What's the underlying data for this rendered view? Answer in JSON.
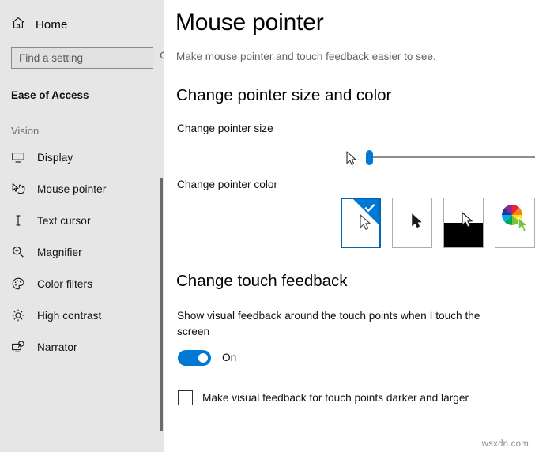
{
  "sidebar": {
    "home_label": "Home",
    "search": {
      "placeholder": "Find a setting",
      "value": "",
      "icon": "search-icon"
    },
    "section_title": "Ease of Access",
    "group_label": "Vision",
    "items": [
      {
        "label": "Display",
        "icon": "monitor-icon",
        "selected": false
      },
      {
        "label": "Mouse pointer",
        "icon": "mouse-pointer-icon",
        "selected": true
      },
      {
        "label": "Text cursor",
        "icon": "text-cursor-icon",
        "selected": false
      },
      {
        "label": "Magnifier",
        "icon": "magnifier-icon",
        "selected": false
      },
      {
        "label": "Color filters",
        "icon": "palette-icon",
        "selected": false
      },
      {
        "label": "High contrast",
        "icon": "brightness-icon",
        "selected": false
      },
      {
        "label": "Narrator",
        "icon": "narrator-icon",
        "selected": false
      }
    ]
  },
  "main": {
    "title": "Mouse pointer",
    "subtitle": "Make mouse pointer and touch feedback easier to see.",
    "size_color_heading": "Change pointer size and color",
    "pointer_size_label": "Change pointer size",
    "pointer_size": {
      "value": 1,
      "min": 1,
      "max": 15
    },
    "pointer_color_label": "Change pointer color",
    "pointer_color_options": [
      {
        "name": "white-pointer",
        "selected": true
      },
      {
        "name": "black-pointer",
        "selected": false
      },
      {
        "name": "inverted-pointer",
        "selected": false
      },
      {
        "name": "custom-color-pointer",
        "selected": false
      }
    ],
    "touch_heading": "Change touch feedback",
    "touch_toggle_text": "Show visual feedback around the touch points when I touch the screen",
    "touch_toggle_state": "On",
    "touch_checkbox_label": "Make visual feedback for touch points darker and larger",
    "touch_checkbox_checked": false,
    "watermark": "wsxdn.com"
  },
  "colors": {
    "accent": "#0078d4",
    "accent_border": "#0067b8",
    "sidebar_bg": "#e6e6e6",
    "content_bg": "#ffffff",
    "text": "#111111",
    "muted_text": "#636363"
  }
}
